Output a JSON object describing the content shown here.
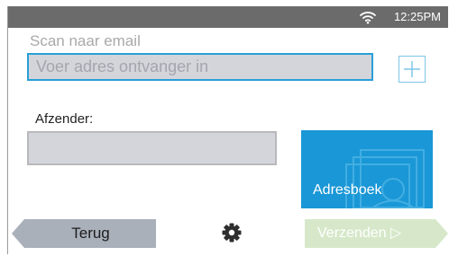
{
  "status_bar": {
    "time": "12:25PM",
    "wifi_icon": "wifi-icon"
  },
  "header": {
    "title": "Scan naar email"
  },
  "recipient": {
    "placeholder": "Voer adres ontvanger in",
    "add_icon": "plus-icon"
  },
  "sender": {
    "label": "Afzender:",
    "value": ""
  },
  "addressbook": {
    "label": "Adresboek",
    "icon": "addressbook-icon"
  },
  "footer": {
    "back_label": "Terug",
    "settings_icon": "gear-icon",
    "send_label": "Verzenden ▷"
  },
  "colors": {
    "status_bar": "#6b6b6b",
    "accent": "#1a97d6",
    "input_fill": "#d3d5db",
    "back_button": "#a9b0ba",
    "send_button_disabled": "#d6e8c9"
  }
}
